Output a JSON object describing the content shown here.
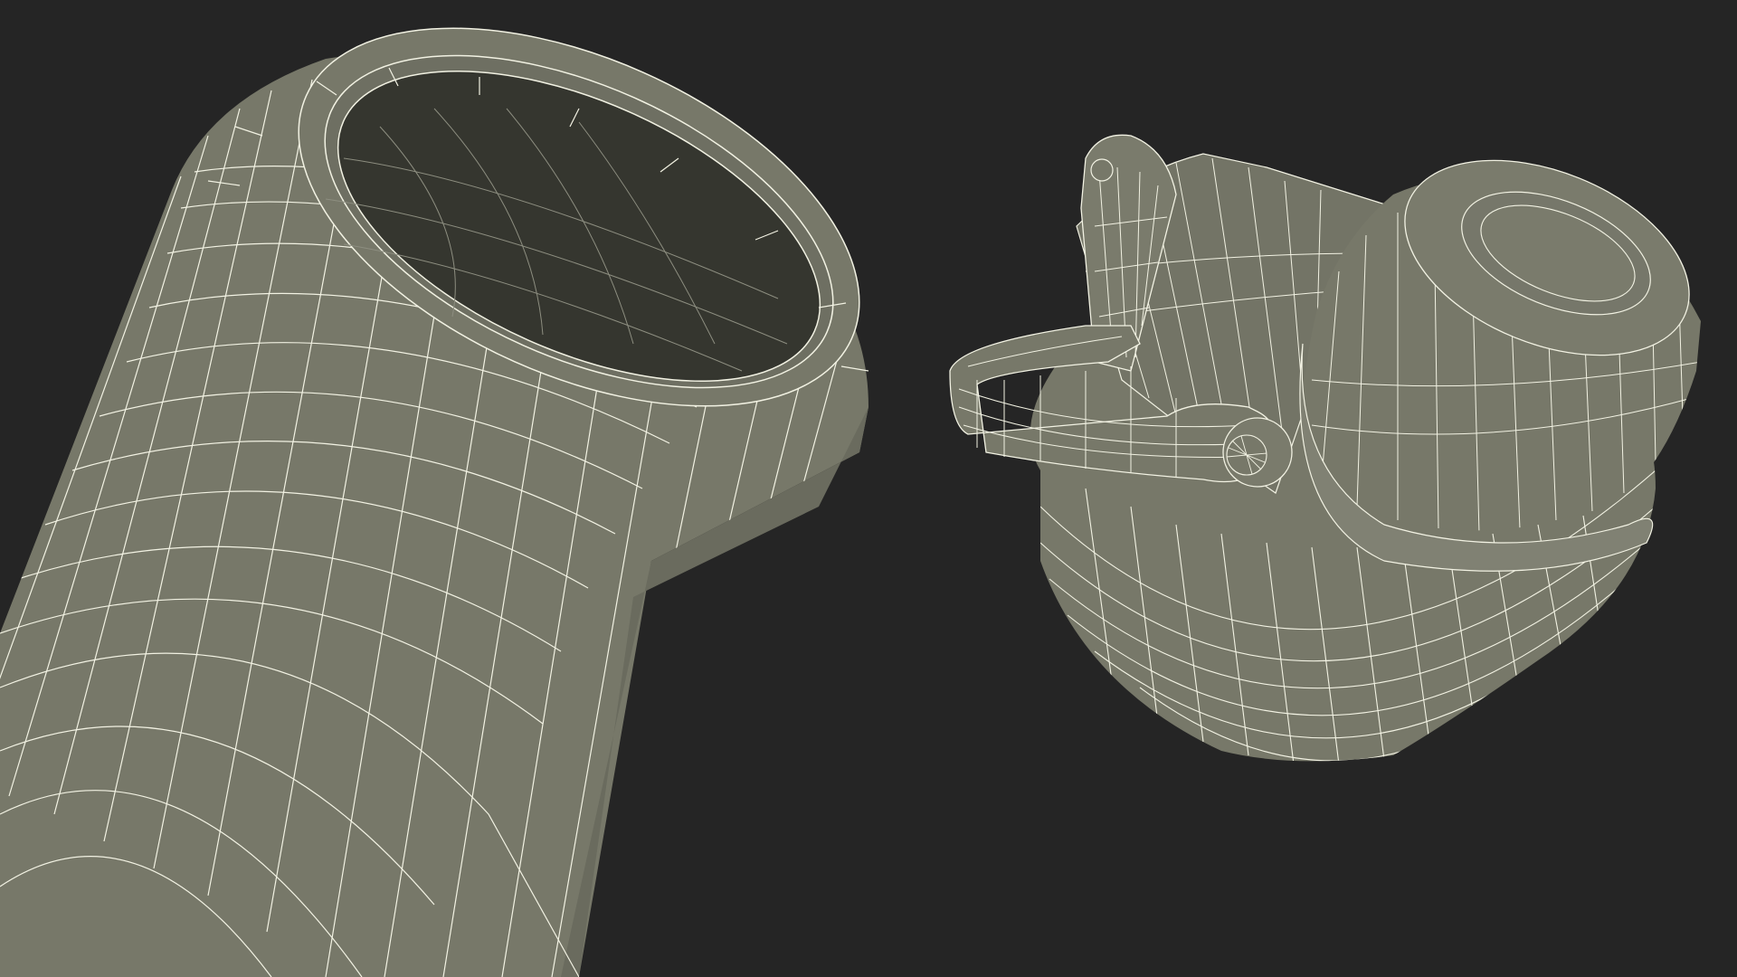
{
  "scene": {
    "background_color": "#252525",
    "surface_color": "#777869",
    "interior_color": "#35362f",
    "wire_color": "#f4f4e6",
    "render_style": "wireframe-over-shaded",
    "objects": [
      {
        "name": "bottle-body",
        "shape": "cylinder-open-top"
      },
      {
        "name": "bottle-cap",
        "shape": "flip-top-cap"
      }
    ]
  }
}
